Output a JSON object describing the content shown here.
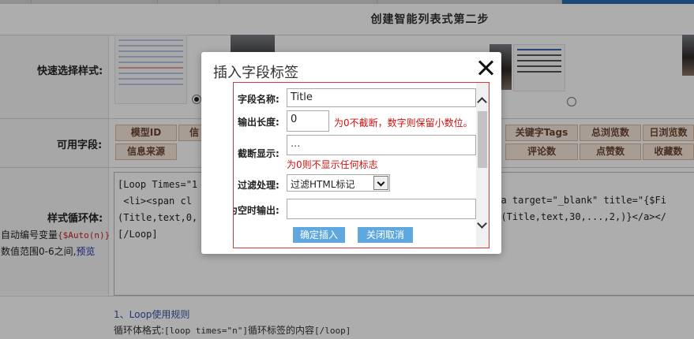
{
  "page": {
    "step_title": "创建智能列表式第二步",
    "labels": {
      "quick_style": "快速选择样式:",
      "fields": "可用字段:",
      "loop_body": "样式循环体:"
    },
    "field_buttons_row1": [
      "模型ID",
      "信",
      "关键字Tags",
      "总浏览数",
      "日浏览数"
    ],
    "field_buttons_row2": [
      "信息来源",
      "评论数",
      "点赞数",
      "收藏数"
    ],
    "code_lines": [
      "[Loop Times=\"1",
      " <li><span cl",
      "(Title,text,0,",
      "[/Loop]"
    ],
    "code_lines_right": [
      "",
      "><a target=\"_blank\" title=\"{$Fi",
      "ld(Title,text,30,...,2,)}</a></",
      ""
    ],
    "side_note_1_prefix": "自动编号变量",
    "side_note_1_var": "{$Auto(n)}",
    "side_note_2_prefix": "数值范围0-6之间,",
    "side_note_2_link": "预览",
    "bottom_link": "1、Loop使用规则",
    "bottom_text_prefix": "循环体格式:",
    "bottom_text_code": "[loop times=\"n\"]",
    "bottom_text_suffix": "循环标签的内容",
    "bottom_text_end": "[/loop]"
  },
  "dialog": {
    "title": "插入字段标签",
    "field_name_label": "字段名称:",
    "field_name_value": "Title",
    "output_length_label": "输出长度:",
    "output_length_value": "0",
    "output_length_hint": "为0不截断，数字则保留小数位。",
    "truncate_label": "截断显示:",
    "truncate_value": "...",
    "truncate_hint": "为0则不显示任何标志",
    "filter_label": "过滤处理:",
    "filter_value": "过滤HTML标记",
    "empty_output_label": "为空时输出:",
    "empty_output_value": "",
    "confirm_button": "确定插入",
    "cancel_button": "关闭取消"
  }
}
